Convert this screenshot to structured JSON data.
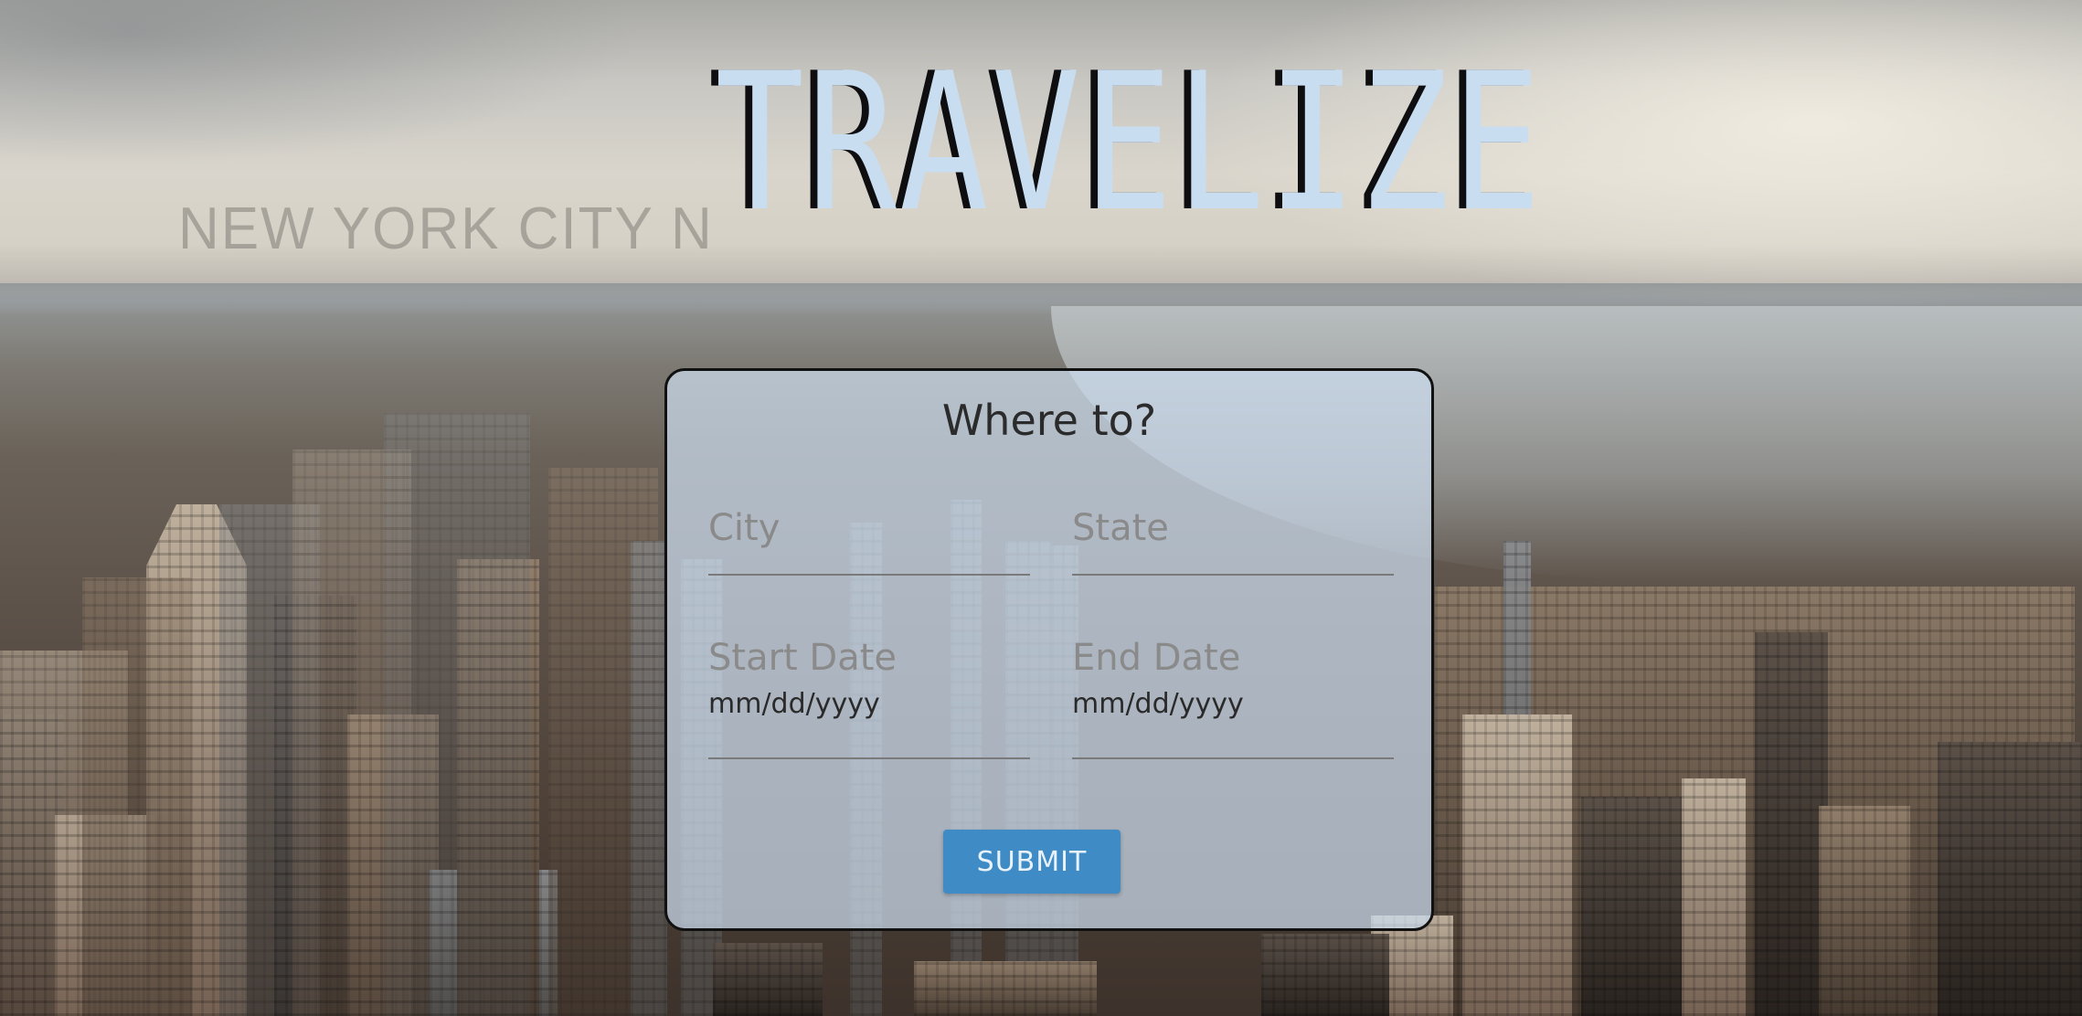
{
  "brand": {
    "title": "TRAVELIZE",
    "background_text": "NEW YORK CITY  N"
  },
  "form": {
    "title": "Where to?",
    "city": {
      "placeholder": "City"
    },
    "state": {
      "placeholder": "State"
    },
    "start_date": {
      "label": "Start Date",
      "value": "mm/dd/yyyy"
    },
    "end_date": {
      "label": "End Date",
      "value": "mm/dd/yyyy"
    },
    "submit_label": "SUBMIT"
  },
  "colors": {
    "brand_text": "#c9ddf1",
    "brand_shadow": "#0e0e10",
    "panel_bg": "rgba(205,222,240,0.72)",
    "submit_bg": "#3f8bc6",
    "placeholder": "#8a8a8a"
  }
}
